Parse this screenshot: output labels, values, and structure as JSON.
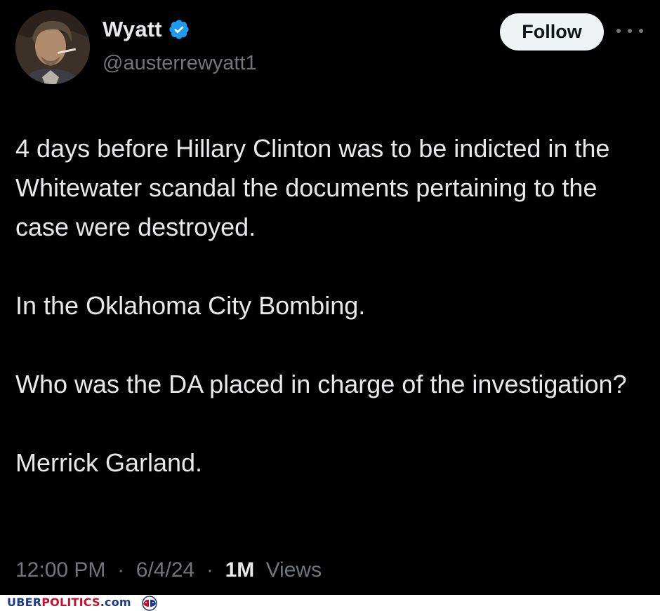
{
  "tweet": {
    "author": {
      "display_name": "Wyatt",
      "handle": "@austerrewyatt1",
      "verified": true,
      "verified_color": "#1d9bf0"
    },
    "follow_label": "Follow",
    "body_paragraphs": [
      "4 days before Hillary Clinton was to be indicted in the Whitewater scandal the documents pertaining to the case were destroyed.",
      "In the Oklahoma City Bombing.",
      "Who was the DA placed in charge of the investigation?",
      "Merrick Garland."
    ],
    "time": "12:00 PM",
    "date": "6/4/24",
    "separator": "·",
    "views_count": "1M",
    "views_label": "Views"
  },
  "watermark": {
    "part1": "UBER",
    "part2": "POLITICS",
    "part3": ".com"
  },
  "icons": {
    "verified": "verified-badge-icon",
    "more": "more-options-icon",
    "watermark_logo": "elephant-donkey-logo-icon"
  }
}
